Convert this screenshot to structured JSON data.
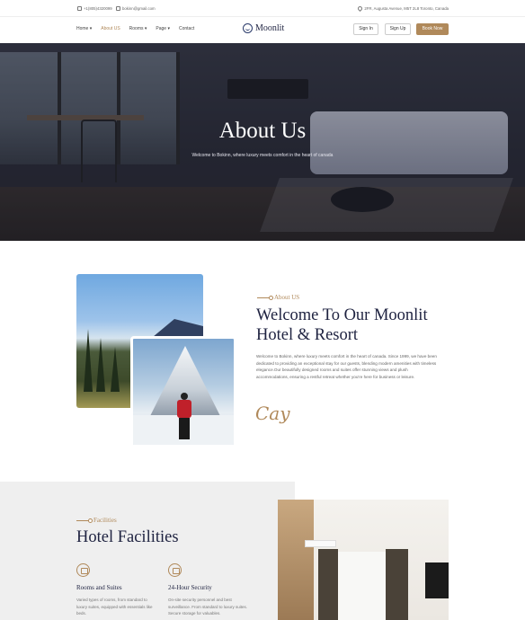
{
  "topbar": {
    "phone": "+1(805)4320099",
    "email": "bokinn@gmail.com",
    "address": "2FR, Augusta Avenue, M5T 2L8 Toronto, Canada"
  },
  "nav": {
    "menu": [
      "Home",
      "About US",
      "Rooms",
      "Page",
      "Contact"
    ],
    "logo": "Moonlit",
    "sign_in": "Sign In",
    "sign_up": "Sign Up",
    "book_now": "Book Now"
  },
  "hero": {
    "title": "About Us",
    "subtitle": "Welcome to Bokinn, where luxury meets comfort in the heart of canada"
  },
  "about": {
    "eyebrow": "About US",
    "title_line1": "Welcome To Our Moonlit",
    "title_line2": "Hotel & Resort",
    "text": "Welcome to Bokinn, where luxury meets comfort in the heart of canada. Since 1999, we have been dedicated to providing an exceptional stay for our guests, blending modern amenities with timeless elegance.Our beautifully designed rooms and suites offer stunning views and plush accommodations, ensuring a restful retreat whether you're here for business or leisure.",
    "signature": "Cay"
  },
  "facilities": {
    "eyebrow": "Facilities",
    "title": "Hotel Facilities",
    "items": [
      {
        "icon": "bed-icon",
        "title": "Rooms and Suites",
        "text": "Varied types of rooms, from standard to luxury suites, equipped with essentials like beds."
      },
      {
        "icon": "security-icon",
        "title": "24-Hour Security",
        "text": "On-site security personnel and best surveillance. From standard to luxury suites. Secure storage for valuables."
      }
    ]
  },
  "colors": {
    "accent": "#b0895a",
    "navy": "#1e2240"
  }
}
